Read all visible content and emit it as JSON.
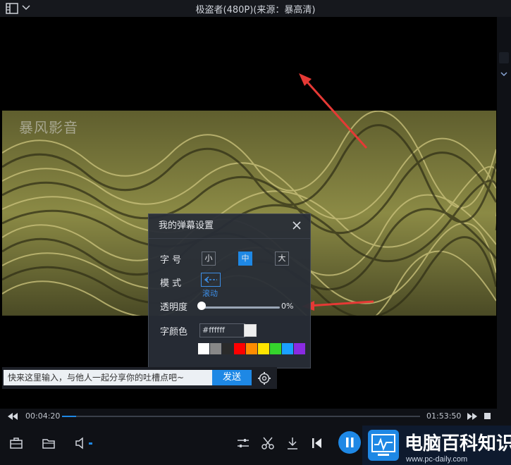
{
  "titlebar": {
    "title": "极盗者(480P)(来源：暴高清)"
  },
  "video": {
    "watermark": "暴风影音"
  },
  "danmaku_panel": {
    "title": "我的弹幕设置",
    "font_size_label": "字 号",
    "sizes": [
      "小",
      "中",
      "大"
    ],
    "selected_size": "中",
    "mode_label": "模 式",
    "mode_value": "滚动",
    "opacity_label": "透明度",
    "opacity_value": "0%",
    "opacity": 0,
    "color_label": "字颜色",
    "color_hex": "#ffffff",
    "swatches": [
      "#ffffff",
      "#888888",
      "#2a2a2a",
      "#ff0000",
      "#ff8c00",
      "#ffe400",
      "#35d42c",
      "#1aa0ff",
      "#8a2be2"
    ]
  },
  "danmaku_input": {
    "placeholder": "快来这里输入，与他人一起分享你的吐槽点吧~",
    "send_label": "发送"
  },
  "player": {
    "elapsed": "00:04:20",
    "total": "01:53:50",
    "progress": 0.04
  },
  "colors": {
    "accent": "#1e88e5",
    "bar": "#0f1116"
  },
  "logo": {
    "name": "电脑百科知识",
    "url": "www.pc-daily.com"
  }
}
